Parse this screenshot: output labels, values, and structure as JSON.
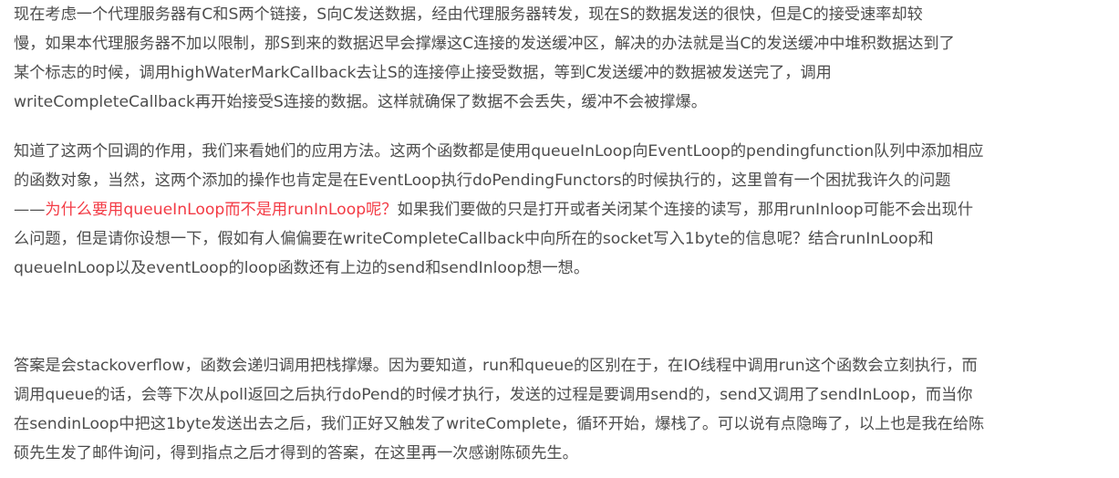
{
  "paragraph_1": {
    "lines": [
      "现在考虑一个代理服务器有C和S两个链接，S向C发送数据，经由代理服务器转发，现在S的数据发送的很快，但是C的接受速率却较",
      "慢，如果本代理服务器不加以限制，那S到来的数据迟早会撑爆这C连接的发送缓冲区，解决的办法就是当C的发送缓冲中堆积数据达到了",
      "某个标志的时候，调用highWaterMarkCallback去让S的连接停止接受数据，等到C发送缓冲的数据被发送完了，调用",
      "writeCompleteCallback再开始接受S连接的数据。这样就确保了数据不会丢失，缓冲不会被撑爆。"
    ]
  },
  "paragraph_2": {
    "line_1": "知道了这两个回调的作用，我们来看她们的应用方法。这两个函数都是使用queueInLoop向EventLoop的pendingfunction队列中添加相应",
    "line_2": "的函数对象，当然，这两个添加的操作也肯定是在EventLoop执行doPendingFunctors的时候执行的，这里曾有一个困扰我许久的问题",
    "line_3_dash": "——",
    "line_3_highlight": "为什么要用queueInLoop而不是用runInLoop呢？",
    "line_3_rest": "如果我们要做的只是打开或者关闭某个连接的读写，那用runInloop可能不会出现什",
    "line_4": "么问题，但是请你设想一下，假如有人偏偏要在writeCompleteCallback中向所在的socket写入1byte的信息呢？结合runInLoop和",
    "line_5": "queueInLoop以及eventLoop的loop函数还有上边的send和sendInloop想一想。"
  },
  "paragraph_3": {
    "lines": [
      "答案是会stackoverflow，函数会递归调用把栈撑爆。因为要知道，run和queue的区别在于，在IO线程中调用run这个函数会立刻执行，而",
      "调用queue的话，会等下次从poll返回之后执行doPend的时候才执行，发送的过程是要调用send的，send又调用了sendInLoop，而当你",
      "在sendinLoop中把这1byte发送出去之后，我们正好又触发了writeComplete，循环开始，爆栈了。可以说有点隐晦了，以上也是我在给陈",
      "硕先生发了邮件询问，得到指点之后才得到的答案，在这里再一次感谢陈硕先生。"
    ]
  },
  "colors": {
    "text": "#4d4d4d",
    "highlight": "#f33b45",
    "background": "#ffffff"
  }
}
